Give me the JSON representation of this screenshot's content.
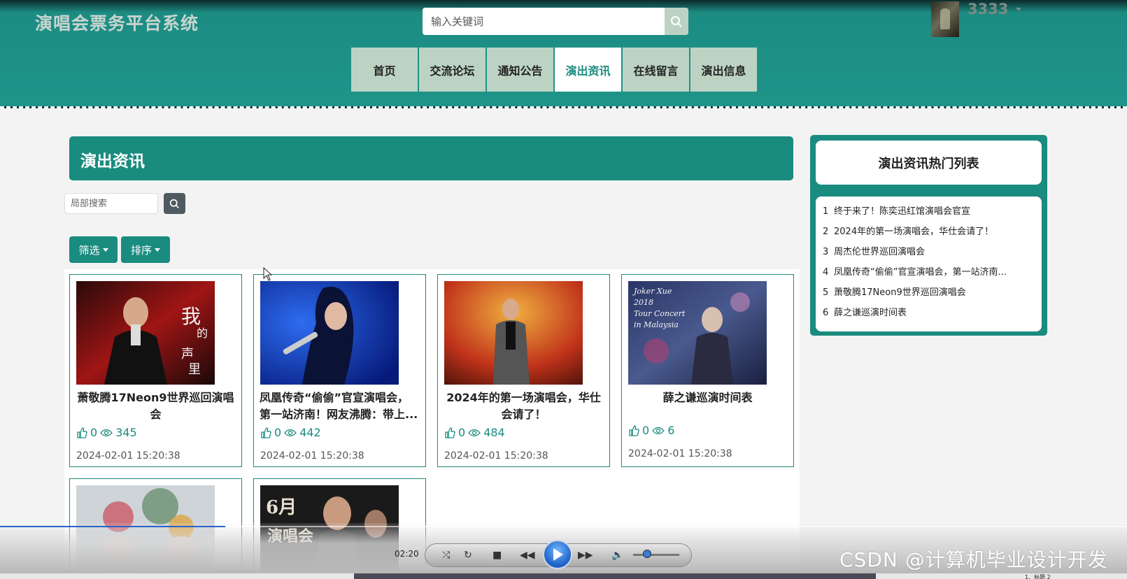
{
  "header": {
    "site_title": "演唱会票务平台系统",
    "search_placeholder": "输入关键词",
    "username": "3333"
  },
  "nav": {
    "items": [
      {
        "label": "首页"
      },
      {
        "label": "交流论坛"
      },
      {
        "label": "通知公告"
      },
      {
        "label": "演出资讯",
        "active": true
      },
      {
        "label": "在线留言"
      },
      {
        "label": "演出信息"
      }
    ]
  },
  "main": {
    "title": "演出资讯",
    "local_search_placeholder": "局部搜索",
    "filter_label": "筛选",
    "sort_label": "排序",
    "cards": [
      {
        "title": "萧敬腾17Neon9世界巡回演唱会",
        "likes": "0",
        "views": "345",
        "date": "2024-02-01 15:20:38"
      },
      {
        "title": "凤凰传奇“偷偷”官宣演唱会，第一站济南！网友沸腾：带上...",
        "likes": "0",
        "views": "442",
        "date": "2024-02-01 15:20:38"
      },
      {
        "title": "2024年的第一场演唱会，华仕会请了！",
        "likes": "0",
        "views": "484",
        "date": "2024-02-01 15:20:38"
      },
      {
        "title": "薛之谦巡演时间表",
        "likes": "0",
        "views": "6",
        "date": "2024-02-01 15:20:38"
      }
    ],
    "card_image_texts": {
      "card1": "我的歌声里",
      "card4": "Joker Xue 2018 Tour Concert in Malaysia",
      "card6": "6月黄埔演唱会"
    }
  },
  "sidebar": {
    "title": "演出资讯热门列表",
    "items": [
      {
        "num": "1",
        "label": "终于来了！陈奕迅红馆演唱会官宣"
      },
      {
        "num": "2",
        "label": "2024年的第一场演唱会，华仕会请了！"
      },
      {
        "num": "3",
        "label": "周杰伦世界巡回演唱会"
      },
      {
        "num": "4",
        "label": "凤凰传奇“偷偷”官宣演唱会，第一站济南..."
      },
      {
        "num": "5",
        "label": "萧敬腾17Neon9世界巡回演唱会"
      },
      {
        "num": "6",
        "label": "薛之谦巡演时间表"
      }
    ]
  },
  "player": {
    "time": "02:20",
    "progress": 0.2,
    "volume": 0.3,
    "watermark": "CSDN @计算机毕业设计开发",
    "taskbar_text": "1、标题 2"
  },
  "colors": {
    "primary": "#1a8b7f",
    "nav_bg": "#bcd3c4",
    "page_bg": "#f3f3f3"
  }
}
